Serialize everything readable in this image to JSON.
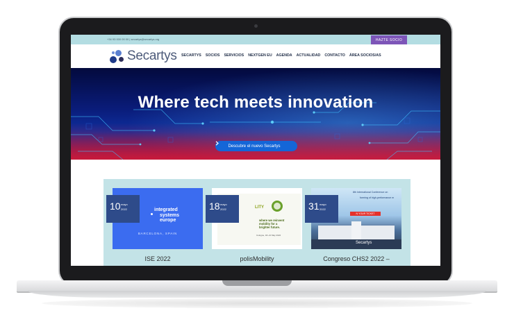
{
  "topbar": {
    "contact": "+34 93 000 00 00 | secartys@secartys.org",
    "cta_label": "HAZTE SOCIO"
  },
  "brand": {
    "name": "Secartys",
    "mark_colors": [
      "#1e3a8a",
      "#5a7fd0",
      "#2d2d5a"
    ]
  },
  "nav": {
    "items": [
      {
        "label": "SECARTYS"
      },
      {
        "label": "SOCIOS"
      },
      {
        "label": "SERVICIOS"
      },
      {
        "label": "NEXTGEN EU"
      },
      {
        "label": "AGENDA"
      },
      {
        "label": "ACTUALIDAD"
      },
      {
        "label": "CONTACTO"
      },
      {
        "label": "ÁREA SOCIOS/AS"
      }
    ]
  },
  "hero": {
    "title": "Where tech meets innovation",
    "button_label": "Descubre el nuevo Secartys",
    "button_icon": "chevron-right-icon"
  },
  "events": [
    {
      "day": "10",
      "month": "mayo",
      "year": "2022",
      "title": "ISE 2022",
      "image": {
        "logo_line1": "integrated",
        "logo_line2": "systems",
        "logo_line3": "europe",
        "location": "BARCELONA, SPAIN",
        "bg": "#3b6cf0"
      }
    },
    {
      "day": "18",
      "month": "mayo",
      "year": "2022",
      "title": "polisMobility",
      "image": {
        "tag": "LITY",
        "line1": "where we reinvent",
        "line2": "mobility for a",
        "line3": "brighter future.",
        "sub": "Cologne, 18–21 May 2022"
      }
    },
    {
      "day": "31",
      "month": "mayo",
      "year": "2022",
      "title": "Congreso CHS2 2022 –",
      "image": {
        "line1": "8th International Conference on",
        "line2": "forming of high-performance m",
        "ticket": "N YOUR TICKET",
        "brand": "Secartys"
      }
    }
  ],
  "colors": {
    "topbar": "#b3dde2",
    "cta": "#7d55b8",
    "hero_button": "#1466d8",
    "events_bg": "#c3e3e7",
    "date_badge": "#2e4b8a"
  }
}
